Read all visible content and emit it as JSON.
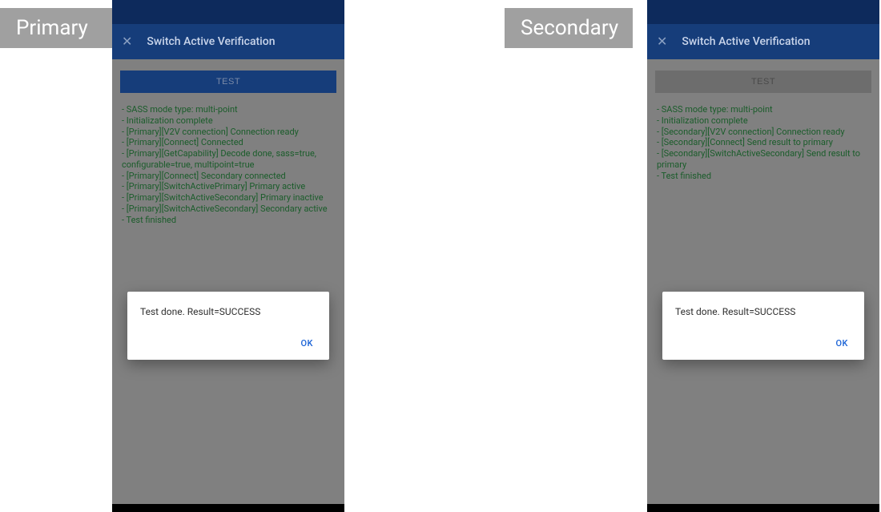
{
  "tags": {
    "primary": "Primary",
    "secondary": "Secondary"
  },
  "appbar": {
    "title": "Switch Active Verification",
    "close": "✕"
  },
  "buttons": {
    "test": "TEST"
  },
  "dialog": {
    "message": "Test done. Result=SUCCESS",
    "ok": "OK"
  },
  "logs": {
    "primary": [
      "- SASS mode type: multi-point",
      "- Initialization complete",
      "- [Primary][V2V connection] Connection ready",
      "- [Primary][Connect] Connected",
      "- [Primary][GetCapability] Decode done, sass=true, configurable=true, multipoint=true",
      "- [Primary][Connect] Secondary connected",
      "- [Primary][SwitchActivePrimary] Primary active",
      "- [Primary][SwitchActiveSecondary] Primary inactive",
      "- [Primary][SwitchActiveSecondary] Secondary active",
      "- Test finished"
    ],
    "secondary": [
      "- SASS mode type: multi-point",
      "- Initialization complete",
      "- [Secondary][V2V connection] Connection ready",
      "- [Secondary][Connect] Send result to primary",
      "- [Secondary][SwitchActiveSecondary] Send result to primary",
      "- Test finished"
    ]
  }
}
